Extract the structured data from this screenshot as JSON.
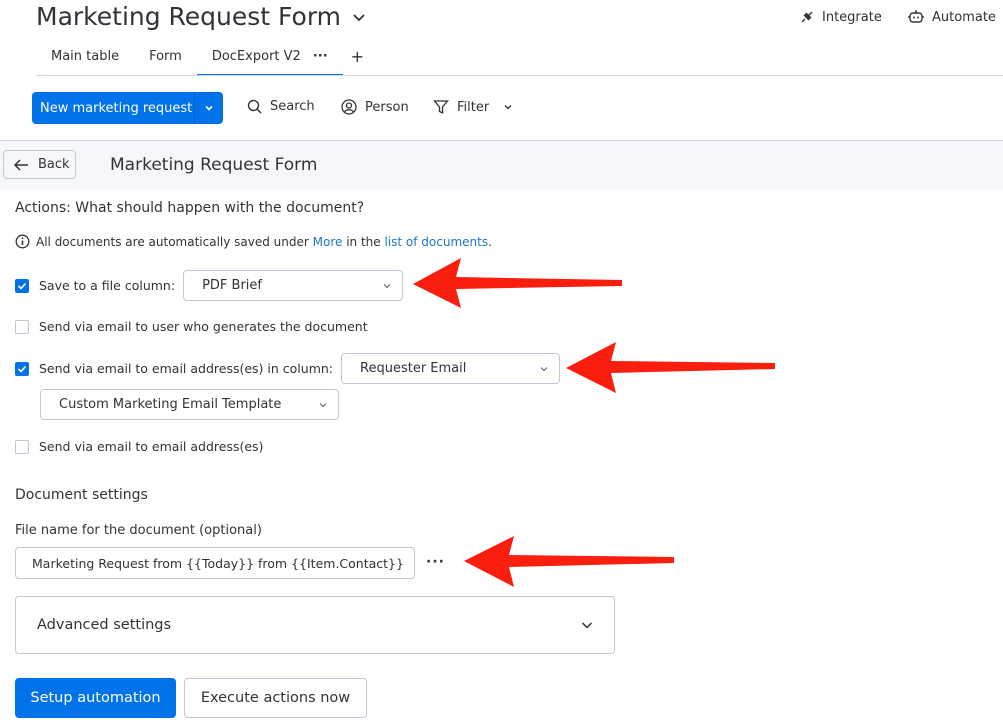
{
  "header": {
    "board_title": "Marketing Request Form",
    "integrate_label": "Integrate",
    "automate_label": "Automate"
  },
  "tabs": [
    {
      "label": "Main table",
      "active": false
    },
    {
      "label": "Form",
      "active": false
    },
    {
      "label": "DocExport V2",
      "active": true
    }
  ],
  "tab_more": "···",
  "tab_add": "+",
  "toolbar": {
    "new_item_label": "New marketing request",
    "search_label": "Search",
    "person_label": "Person",
    "filter_label": "Filter"
  },
  "panel": {
    "back_label": "Back",
    "title": "Marketing Request Form"
  },
  "actions": {
    "question": "Actions: What should happen with the document?",
    "info_prefix": "All documents are automatically saved under ",
    "info_link1": "More",
    "info_middle": " in the ",
    "info_link2": "list of documents",
    "info_suffix": ".",
    "save_to_column": {
      "label": "Save to a file column:",
      "checked": true,
      "value": "PDF Brief"
    },
    "send_to_generator": {
      "label": "Send via email to user who generates the document",
      "checked": false
    },
    "send_to_column": {
      "label": "Send via email to email address(es) in column:",
      "checked": true,
      "value": "Requester Email",
      "template": "Custom Marketing Email Template"
    },
    "send_to_addresses": {
      "label": "Send via email to email address(es)",
      "checked": false
    }
  },
  "document_settings": {
    "heading": "Document settings",
    "file_name_label": "File name for the document (optional)",
    "file_name_value": "Marketing Request from {{Today}} from {{Item.Contact}}",
    "more_label": "···"
  },
  "advanced_label": "Advanced settings",
  "buttons": {
    "setup": "Setup automation",
    "execute": "Execute actions now"
  },
  "colors": {
    "primary": "#0073ea",
    "annotation_arrow": "#fa1e0e",
    "link": "#1f76c2"
  }
}
